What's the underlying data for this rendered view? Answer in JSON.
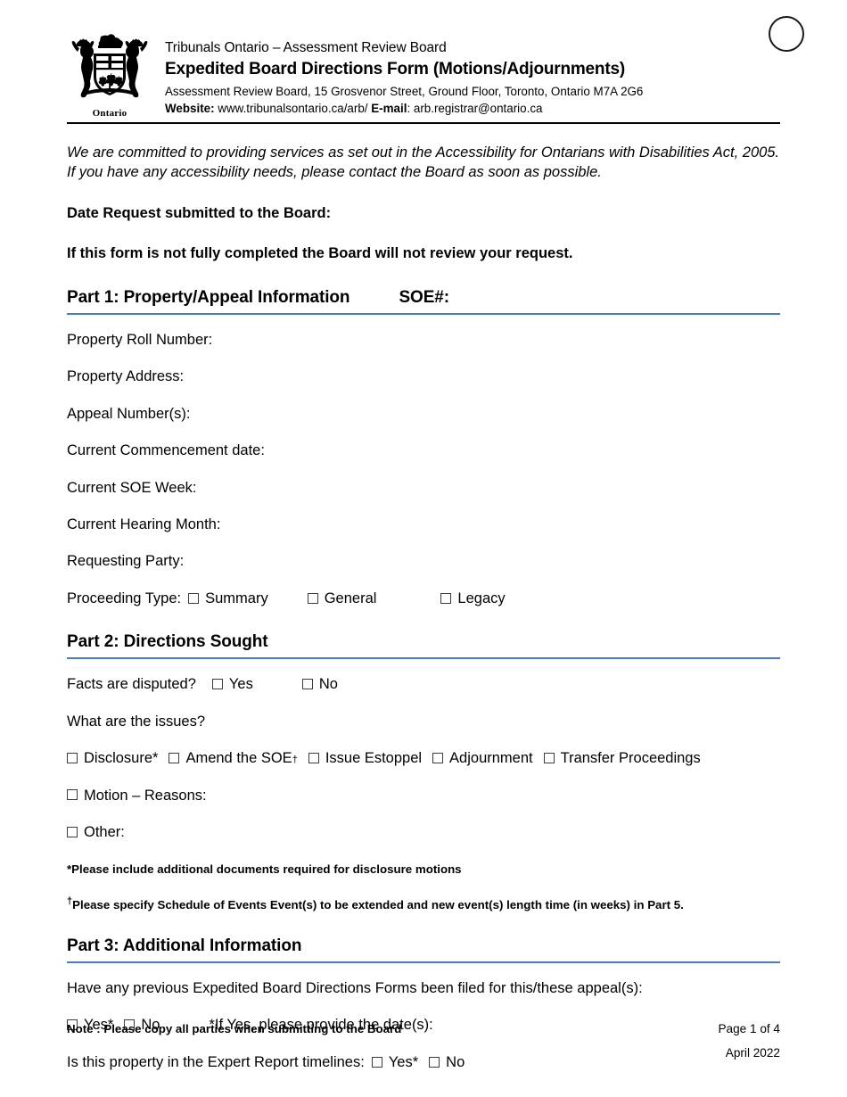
{
  "header": {
    "crest_word": "Ontario",
    "org_line": "Tribunals Ontario – Assessment Review Board",
    "form_title": "Expedited Board Directions Form (Motions/Adjournments)",
    "address_line": "Assessment Review Board, 15 Grosvenor Street, Ground Floor, Toronto, Ontario M7A 2G6",
    "website_label": "Website:",
    "website_value": "www.tribunalsontario.ca/arb/",
    "email_label": "E-mail",
    "email_value": ": arb.registrar@ontario.ca"
  },
  "intro": {
    "accessibility": "We are committed to providing services as set out in the Accessibility for Ontarians with Disabilities Act, 2005. If you have any accessibility needs, please contact the Board as soon as possible.",
    "date_request": "Date Request submitted to the Board:",
    "incomplete_warning": "If this form is not fully completed the Board will not review your request."
  },
  "part1": {
    "heading": "Part 1: Property/Appeal Information",
    "soe_label": "SOE#:",
    "fields": [
      "Property Roll Number:",
      "Property Address:",
      "Appeal Number(s):",
      "Current Commencement date:",
      "Current SOE Week:",
      "Current Hearing Month:",
      "Requesting Party:"
    ],
    "proceeding_label": "Proceeding Type:",
    "proceeding_options": [
      "Summary",
      "General",
      "Legacy"
    ]
  },
  "part2": {
    "heading": "Part 2: Directions Sought",
    "facts_label": "Facts are disputed?",
    "facts_options": [
      "Yes",
      "No"
    ],
    "issues_question": "What are the issues?",
    "issue_options": [
      "Disclosure*",
      "Amend the SOE",
      "Issue Estoppel",
      "Adjournment",
      "Transfer Proceedings"
    ],
    "amend_sup": "†",
    "motion_label": "Motion – Reasons:",
    "other_label": "Other:",
    "footnote_star": "*Please include additional documents required for disclosure motions",
    "footnote_dagger_sup": "†",
    "footnote_dagger": "Please specify Schedule of Events Event(s) to be extended and new event(s) length time (in weeks) in Part 5."
  },
  "part3": {
    "heading": "Part 3: Additional Information",
    "previous_question": "Have any previous Expedited Board Directions Forms been filed for this/these appeal(s):",
    "previous_options": [
      "Yes*",
      "No"
    ],
    "if_yes_note": "*If Yes, please provide the date(s):",
    "expert_label": "Is this property in the Expert Report timelines:",
    "expert_options": [
      "Yes*",
      "No"
    ]
  },
  "footer": {
    "note": "Note : Please copy all parties when submitting to the Board",
    "page": "Page 1 of 4",
    "date": "April 2022"
  },
  "colors": {
    "section_rule": "#4a7ebb",
    "header_rule": "#000000",
    "text": "#000000"
  }
}
